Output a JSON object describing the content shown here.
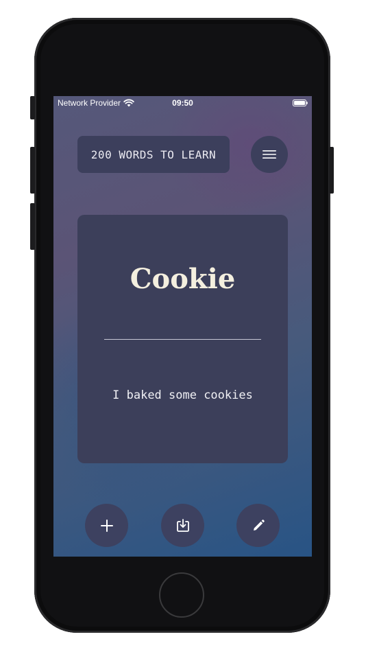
{
  "status_bar": {
    "carrier": "Network Provider",
    "time": "09:50"
  },
  "header": {
    "title": "200 WORDS TO LEARN",
    "menu_icon": "hamburger-menu-icon"
  },
  "card": {
    "word": "Cookie",
    "example": "I baked some cookies"
  },
  "actions": [
    {
      "name": "add",
      "icon": "plus-icon"
    },
    {
      "name": "import",
      "icon": "download-tray-icon"
    },
    {
      "name": "edit",
      "icon": "pencil-icon"
    }
  ],
  "colors": {
    "button_bg": "#3c3f5c",
    "card_bg": "#3c3f5a",
    "word_color": "#f4efdf"
  }
}
